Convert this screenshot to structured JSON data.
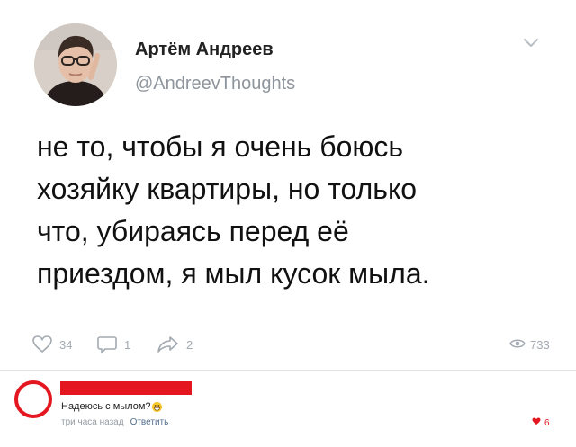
{
  "tweet": {
    "author_name": "Артём Андреев",
    "author_handle": "@AndreevThoughts",
    "text_lines": [
      "не то, чтобы я очень боюсь",
      "хозяйку квартиры, но только",
      "что, убираясь перед её",
      "приездом, я мыл кусок мыла."
    ],
    "actions": {
      "likes": "34",
      "replies": "1",
      "reposts": "2",
      "views": "733"
    },
    "icons": {
      "menu": "chevron-down-icon",
      "like": "heart-icon",
      "reply": "comment-icon",
      "repost": "share-arrow-icon",
      "views": "eye-icon"
    }
  },
  "comment": {
    "text": "Надеюсь с мылом?",
    "emoji": "grinning-face-emoji",
    "time": "три часа назад",
    "reply_label": "Ответить",
    "likes": "6",
    "icons": {
      "like": "heart-icon"
    }
  },
  "colors": {
    "accent_red": "#e4161f",
    "muted_gray": "#a3aab1",
    "link_blue": "#556f8f"
  }
}
